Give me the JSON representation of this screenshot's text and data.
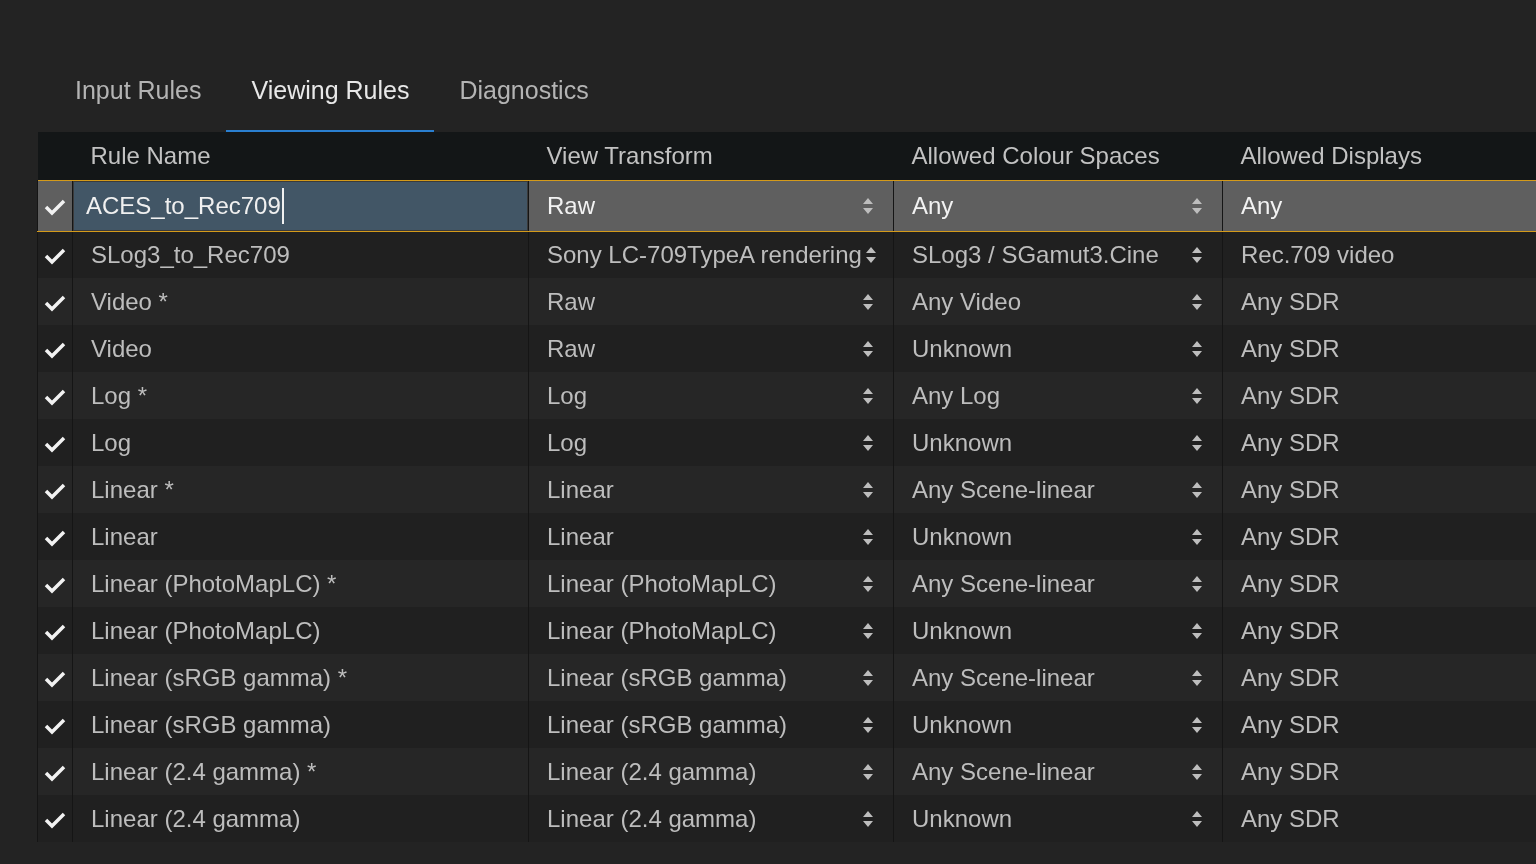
{
  "tabs": [
    {
      "label": "Input Rules",
      "selected": false
    },
    {
      "label": "Viewing Rules",
      "selected": true
    },
    {
      "label": "Diagnostics",
      "selected": false
    }
  ],
  "table": {
    "columns": [
      "Rule Name",
      "View Transform",
      "Allowed Colour Spaces",
      "Allowed Displays"
    ],
    "rows": [
      {
        "enabled": true,
        "selected": true,
        "editing": true,
        "rule_name": "ACES_to_Rec709",
        "view_transform": "Raw",
        "colour_spaces": "Any",
        "displays": "Any"
      },
      {
        "enabled": true,
        "selected": false,
        "editing": false,
        "rule_name": "SLog3_to_Rec709",
        "view_transform": "Sony LC-709TypeA rendering",
        "colour_spaces": "SLog3 / SGamut3.Cine",
        "displays": "Rec.709 video"
      },
      {
        "enabled": true,
        "selected": false,
        "editing": false,
        "rule_name": "Video *",
        "view_transform": "Raw",
        "colour_spaces": "Any Video",
        "displays": "Any SDR"
      },
      {
        "enabled": true,
        "selected": false,
        "editing": false,
        "rule_name": "Video",
        "view_transform": "Raw",
        "colour_spaces": "Unknown",
        "displays": "Any SDR"
      },
      {
        "enabled": true,
        "selected": false,
        "editing": false,
        "rule_name": "Log *",
        "view_transform": "Log",
        "colour_spaces": "Any Log",
        "displays": "Any SDR"
      },
      {
        "enabled": true,
        "selected": false,
        "editing": false,
        "rule_name": "Log",
        "view_transform": "Log",
        "colour_spaces": "Unknown",
        "displays": "Any SDR"
      },
      {
        "enabled": true,
        "selected": false,
        "editing": false,
        "rule_name": "Linear *",
        "view_transform": "Linear",
        "colour_spaces": "Any Scene-linear",
        "displays": "Any SDR"
      },
      {
        "enabled": true,
        "selected": false,
        "editing": false,
        "rule_name": "Linear",
        "view_transform": "Linear",
        "colour_spaces": "Unknown",
        "displays": "Any SDR"
      },
      {
        "enabled": true,
        "selected": false,
        "editing": false,
        "rule_name": "Linear (PhotoMapLC) *",
        "view_transform": "Linear (PhotoMapLC)",
        "colour_spaces": "Any Scene-linear",
        "displays": "Any SDR"
      },
      {
        "enabled": true,
        "selected": false,
        "editing": false,
        "rule_name": "Linear (PhotoMapLC)",
        "view_transform": "Linear (PhotoMapLC)",
        "colour_spaces": "Unknown",
        "displays": "Any SDR"
      },
      {
        "enabled": true,
        "selected": false,
        "editing": false,
        "rule_name": "Linear (sRGB gamma) *",
        "view_transform": "Linear (sRGB gamma)",
        "colour_spaces": "Any Scene-linear",
        "displays": "Any SDR"
      },
      {
        "enabled": true,
        "selected": false,
        "editing": false,
        "rule_name": "Linear (sRGB gamma)",
        "view_transform": "Linear (sRGB gamma)",
        "colour_spaces": "Unknown",
        "displays": "Any SDR"
      },
      {
        "enabled": true,
        "selected": false,
        "editing": false,
        "rule_name": "Linear (2.4 gamma) *",
        "view_transform": "Linear (2.4 gamma)",
        "colour_spaces": "Any Scene-linear",
        "displays": "Any SDR"
      },
      {
        "enabled": true,
        "selected": false,
        "editing": false,
        "rule_name": "Linear (2.4 gamma)",
        "view_transform": "Linear (2.4 gamma)",
        "colour_spaces": "Unknown",
        "displays": "Any SDR"
      }
    ]
  }
}
